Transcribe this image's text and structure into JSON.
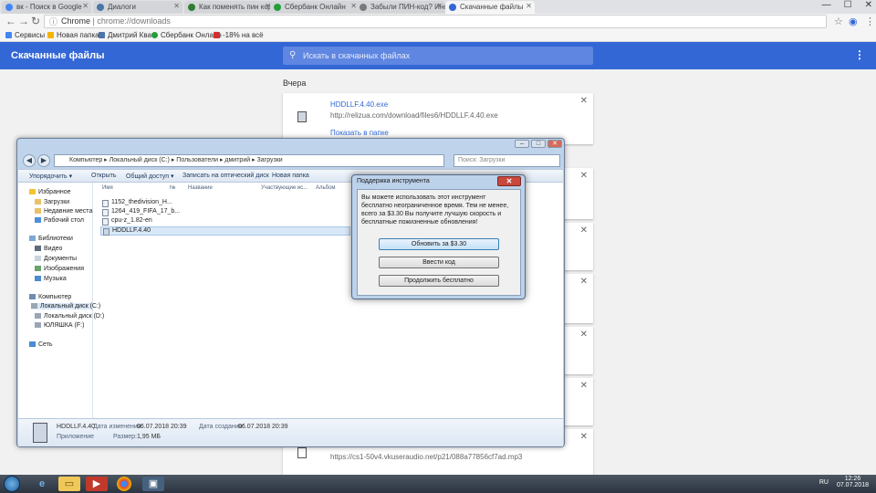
{
  "browser": {
    "tabs": [
      {
        "label": "вк - Поиск в Google",
        "color": "#4285f4",
        "active": false
      },
      {
        "label": "Диалоги",
        "color": "#4a76a8",
        "active": false
      },
      {
        "label": "Как поменять пин код на",
        "color": "#2e7d32",
        "active": false
      },
      {
        "label": "Сбербанк Онлайн",
        "color": "#21a038",
        "active": false
      },
      {
        "label": "Забыли ПИН-код? Инст",
        "color": "#7a7a7a",
        "active": false
      },
      {
        "label": "Скачанные файлы",
        "color": "#3367d6",
        "active": true
      }
    ],
    "window_buttons": [
      "—",
      "☐",
      "✕"
    ],
    "omnibox": {
      "scheme": "Chrome",
      "separator": " | ",
      "url": "chrome://downloads"
    },
    "bookmarks": [
      {
        "label": "Сервисы",
        "color": "#4285f4"
      },
      {
        "label": "Новая папка",
        "color": "#f4b400"
      },
      {
        "label": "Дмитрий Квач",
        "color": "#4a76a8"
      },
      {
        "label": "Сбербанк Онлайн",
        "color": "#21a038"
      },
      {
        "label": "-18% на всё",
        "color": "#d32f2f"
      }
    ]
  },
  "downloads": {
    "title": "Скачанные файлы",
    "search_placeholder": "Искать в скачанных файлах",
    "day_label": "Вчера",
    "card": {
      "file_name": "HDDLLF.4.40.exe",
      "url": "http://relizua.com/download/files6/HDDLLF.4.40.exe",
      "show_in_folder": "Показать в папке"
    },
    "bottom_url": "https://cs1-50v4.vkuseraudio.net/p21/088a77856cf7ad.mp3"
  },
  "explorer": {
    "address": [
      "Компьютер",
      "Локальный диск (C:)",
      "Пользователи",
      "дмитрий",
      "Загрузки"
    ],
    "search_placeholder": "Поиск: Загрузки",
    "commands": [
      "Упорядочить ▾",
      "Открыть",
      "Общий доступ ▾",
      "Записать на оптический диск",
      "Новая папка"
    ],
    "nav": [
      {
        "label": "Избранное",
        "indent": 0
      },
      {
        "label": "Загрузки",
        "indent": 1
      },
      {
        "label": "Недавние места",
        "indent": 1
      },
      {
        "label": "Рабочий стол",
        "indent": 1
      },
      {
        "label": "Библиотеки",
        "indent": 0
      },
      {
        "label": "Видео",
        "indent": 1
      },
      {
        "label": "Документы",
        "indent": 1
      },
      {
        "label": "Изображения",
        "indent": 1
      },
      {
        "label": "Музыка",
        "indent": 1
      },
      {
        "label": "Компьютер",
        "indent": 0
      },
      {
        "label": "Локальный диск (C:)",
        "indent": 1
      },
      {
        "label": "Локальный диск (D:)",
        "indent": 1
      },
      {
        "label": "ЮЛЯШКА (F:)",
        "indent": 1
      },
      {
        "label": "Сеть",
        "indent": 0
      }
    ],
    "columns": [
      "Имя",
      "№",
      "Название",
      "Участвующие ис...",
      "Альбом"
    ],
    "files": [
      "1152_thedivision_H...",
      "1264_419_FIFA_17_b...",
      "cpu-z_1.82-en",
      "HDDLLF.4.40"
    ],
    "details": {
      "name": "HDDLLF.4.40",
      "type": "Приложение",
      "modified_label": "Дата изменения:",
      "modified_value": "06.07.2018 20:39",
      "created_label": "Дата создания:",
      "created_value": "06.07.2018 20:39",
      "size_label": "Размер:",
      "size_value": "1,95 МБ"
    }
  },
  "dialog": {
    "title": "Поддержка инструмента",
    "message": "Вы можете использовать этот инструмент бесплатно неограниченное время. Тем не менее, всего за $3.30 Вы получите лучшую скорость и бесплатные пожизненные обновления!",
    "buttons": [
      "Обновить за $3.30",
      "Ввести код",
      "Продолжить бесплатно"
    ]
  },
  "taskbar": {
    "language": "RU",
    "time": "12:26",
    "date": "07.07.2018"
  }
}
